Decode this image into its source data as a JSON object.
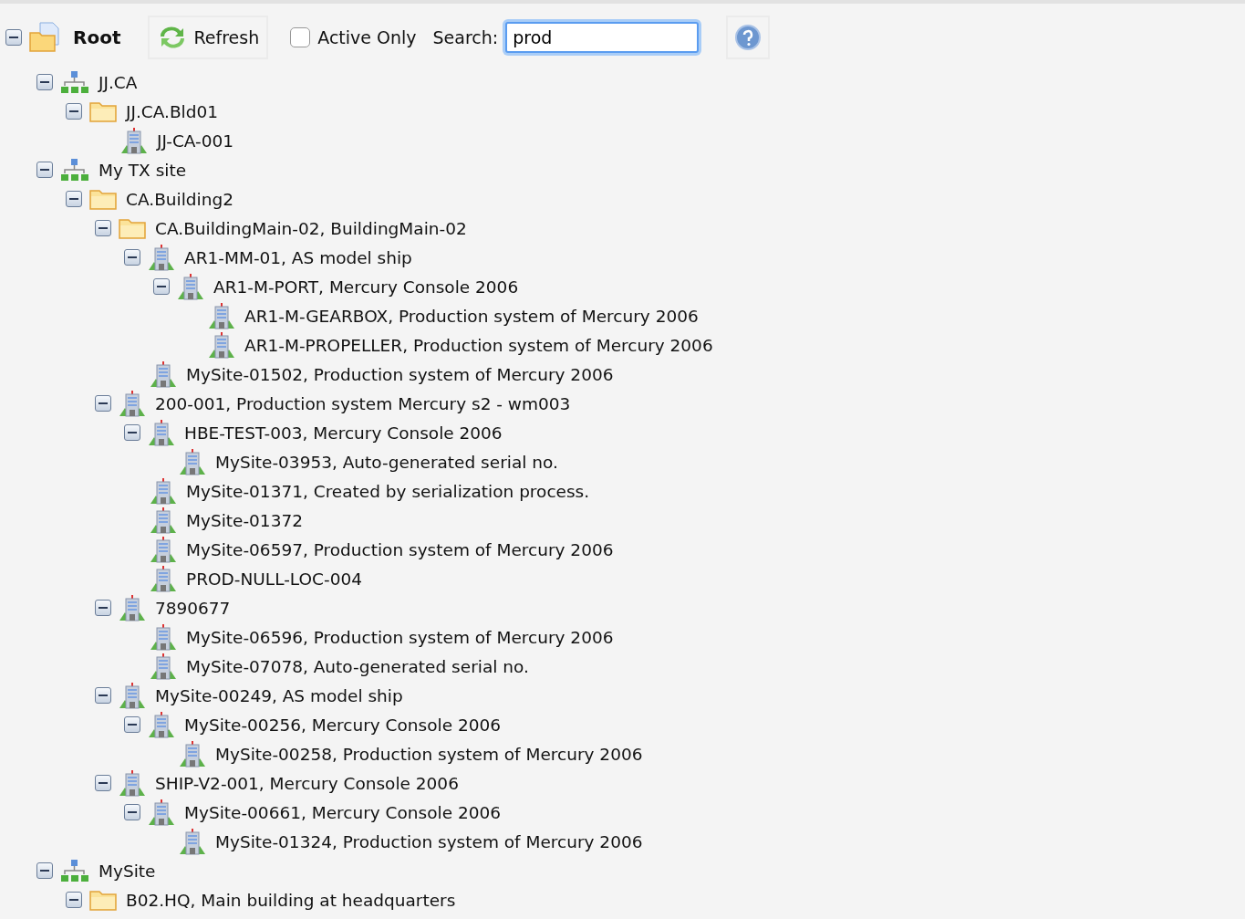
{
  "toolbar": {
    "root": {
      "label": "Root",
      "expanded": true
    },
    "refresh": {
      "label": "Refresh"
    },
    "active_only": {
      "label": "Active Only",
      "checked": false
    },
    "search": {
      "label": "Search:",
      "value": "prod"
    }
  },
  "tree": [
    {
      "kind": "site",
      "label": "JJ.CA",
      "expanded": true,
      "children": [
        {
          "kind": "folder",
          "label": "JJ.CA.Bld01",
          "expanded": true,
          "children": [
            {
              "kind": "building",
              "label": "JJ-CA-001"
            }
          ]
        }
      ]
    },
    {
      "kind": "site",
      "label": "My TX site",
      "expanded": true,
      "children": [
        {
          "kind": "folder",
          "label": "CA.Building2",
          "expanded": true,
          "children": [
            {
              "kind": "folder",
              "label": "CA.BuildingMain-02, BuildingMain-02",
              "expanded": true,
              "children": [
                {
                  "kind": "building",
                  "label": "AR1-MM-01, AS model ship",
                  "expanded": true,
                  "children": [
                    {
                      "kind": "building",
                      "label": "AR1-M-PORT, Mercury Console 2006",
                      "expanded": true,
                      "children": [
                        {
                          "kind": "building",
                          "label": "AR1-M-GEARBOX, Production system of Mercury 2006"
                        },
                        {
                          "kind": "building",
                          "label": "AR1-M-PROPELLER, Production system of Mercury 2006"
                        }
                      ]
                    }
                  ]
                },
                {
                  "kind": "building",
                  "label": "MySite-01502, Production system of Mercury 2006"
                }
              ]
            },
            {
              "kind": "building",
              "label": "200-001, Production system Mercury s2 - wm003",
              "expanded": true,
              "children": [
                {
                  "kind": "building",
                  "label": "HBE-TEST-003, Mercury Console 2006",
                  "expanded": true,
                  "children": [
                    {
                      "kind": "building",
                      "label": "MySite-03953, Auto-generated serial no."
                    }
                  ]
                },
                {
                  "kind": "building",
                  "label": "MySite-01371, Created by serialization process."
                },
                {
                  "kind": "building",
                  "label": "MySite-01372"
                },
                {
                  "kind": "building",
                  "label": "MySite-06597, Production system of Mercury 2006"
                },
                {
                  "kind": "building",
                  "label": "PROD-NULL-LOC-004"
                }
              ]
            },
            {
              "kind": "building",
              "label": "7890677",
              "expanded": true,
              "children": [
                {
                  "kind": "building",
                  "label": "MySite-06596, Production system of Mercury 2006"
                },
                {
                  "kind": "building",
                  "label": "MySite-07078, Auto-generated serial no."
                }
              ]
            },
            {
              "kind": "building",
              "label": "MySite-00249, AS model ship",
              "expanded": true,
              "children": [
                {
                  "kind": "building",
                  "label": "MySite-00256, Mercury Console 2006",
                  "expanded": true,
                  "children": [
                    {
                      "kind": "building",
                      "label": "MySite-00258, Production system of Mercury 2006"
                    }
                  ]
                }
              ]
            },
            {
              "kind": "building",
              "label": "SHIP-V2-001, Mercury Console 2006",
              "expanded": true,
              "children": [
                {
                  "kind": "building",
                  "label": "MySite-00661, Mercury Console 2006",
                  "expanded": true,
                  "children": [
                    {
                      "kind": "building",
                      "label": "MySite-01324, Production system of Mercury 2006"
                    }
                  ]
                }
              ]
            }
          ]
        }
      ]
    },
    {
      "kind": "site",
      "label": "MySite",
      "expanded": true,
      "children": [
        {
          "kind": "folder",
          "label": "B02.HQ, Main building at headquarters",
          "expanded": true
        }
      ]
    }
  ]
}
